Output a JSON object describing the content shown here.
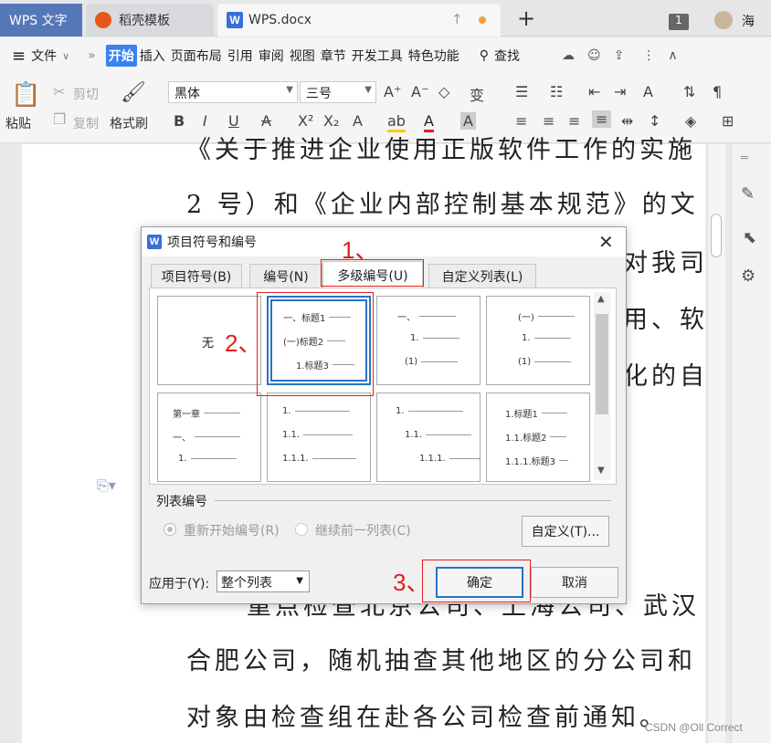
{
  "tabs": {
    "app": "WPS 文字",
    "template": "稻壳模板",
    "doc": "WPS.docx",
    "doc_icon": "W",
    "counter": "1",
    "user_initial": "海"
  },
  "menu": {
    "file": "文件",
    "items": [
      "开始",
      "插入",
      "页面布局",
      "引用",
      "审阅",
      "视图",
      "章节",
      "开发工具",
      "特色功能"
    ],
    "search": "查找"
  },
  "ribbon": {
    "paste": "粘贴",
    "cut": "剪切",
    "copy": "复制",
    "format_painter": "格式刷",
    "font": "黑体",
    "size": "三号"
  },
  "document": {
    "lines": [
      "《关于推进企业使用正版软件工作的实施",
      "2 号）和《企业内部控制基本规范》的文",
      "对我司",
      "用、软",
      "化的自",
      "重点检查北京公司、上海公司、武汉",
      "合肥公司，随机抽查其他地区的分公司和",
      "对象由检查组在赴各公司检查前通知。"
    ]
  },
  "dialog": {
    "title": "项目符号和编号",
    "tabs": [
      "项目符号(B)",
      "编号(N)",
      "多级编号(U)",
      "自定义列表(L)"
    ],
    "none_label": "无",
    "presets": [
      [
        "一、标题1",
        "(一)标题2",
        "1.标题3"
      ],
      [
        "一、",
        "1.",
        "(1)"
      ],
      [
        "(一)",
        "1.",
        "(1)"
      ],
      [
        "第一章",
        "一、",
        "1."
      ],
      [
        "1.",
        "1.1.",
        "1.1.1."
      ],
      [
        "1.",
        "1.1.",
        "1.1.1."
      ],
      [
        "1.标题1",
        "1.1.标题2",
        "1.1.1.标题3"
      ]
    ],
    "list_number_label": "列表编号",
    "restart": "重新开始编号(R)",
    "continue": "继续前一列表(C)",
    "customize": "自定义(T)...",
    "apply_label": "应用于(Y):",
    "apply_value": "整个列表",
    "ok": "确定",
    "cancel": "取消"
  },
  "annotations": [
    "1、",
    "2、",
    "3、"
  ],
  "watermark": "CSDN @Oll Correct",
  "colors": {
    "accent": "#3b82f0",
    "annotation": "#e02020",
    "wps_tab": "#5677b8"
  }
}
